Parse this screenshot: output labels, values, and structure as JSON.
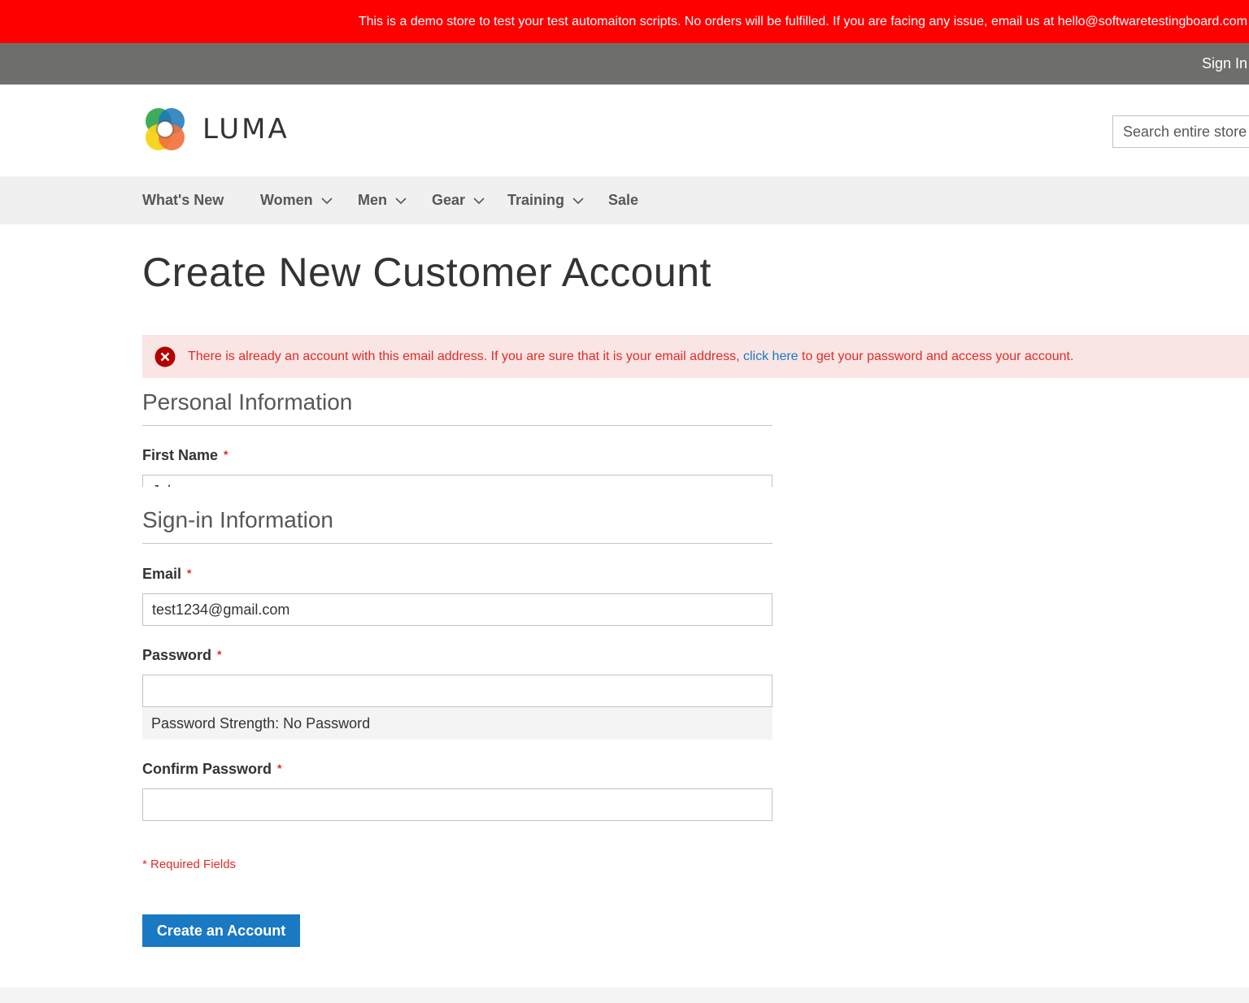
{
  "banner": {
    "text": "This is a demo store to test your test automaiton scripts. No orders will be fulfilled. If you are facing any issue, email us at hello@softwaretestingboard.com"
  },
  "top_links": {
    "sign_in": "Sign In"
  },
  "header": {
    "logo_text": "LUMA",
    "search_placeholder": "Search entire store here..."
  },
  "nav": {
    "items": [
      {
        "label": "What's New",
        "has_dropdown": false
      },
      {
        "label": "Women",
        "has_dropdown": true
      },
      {
        "label": "Men",
        "has_dropdown": true
      },
      {
        "label": "Gear",
        "has_dropdown": true
      },
      {
        "label": "Training",
        "has_dropdown": true
      },
      {
        "label": "Sale",
        "has_dropdown": false
      }
    ]
  },
  "page": {
    "title": "Create New Customer Account"
  },
  "error": {
    "text_before": "There is already an account with this email address. If you are sure that it is your email address,",
    "link_text": "click here",
    "text_after": "to get your password and access your account."
  },
  "personal_info": {
    "title": "Personal Information",
    "first_name_label": "First Name",
    "first_name_value": "John"
  },
  "signin_info": {
    "title": "Sign-in Information",
    "email_label": "Email",
    "email_value": "test1234@gmail.com",
    "password_label": "Password",
    "password_value": "",
    "password_strength": "Password Strength: No Password",
    "confirm_password_label": "Confirm Password",
    "confirm_password_value": ""
  },
  "form": {
    "required_marker": "*",
    "required_note": "* Required Fields",
    "submit_label": "Create an Account"
  },
  "colors": {
    "banner_bg": "#ff0000",
    "top_links_bg": "#6e6e6d",
    "nav_bg": "#f0f0f0",
    "error_bg": "#fae5e5",
    "error_text": "#e02b27",
    "link": "#1979c3",
    "primary_button": "#1979c3"
  }
}
